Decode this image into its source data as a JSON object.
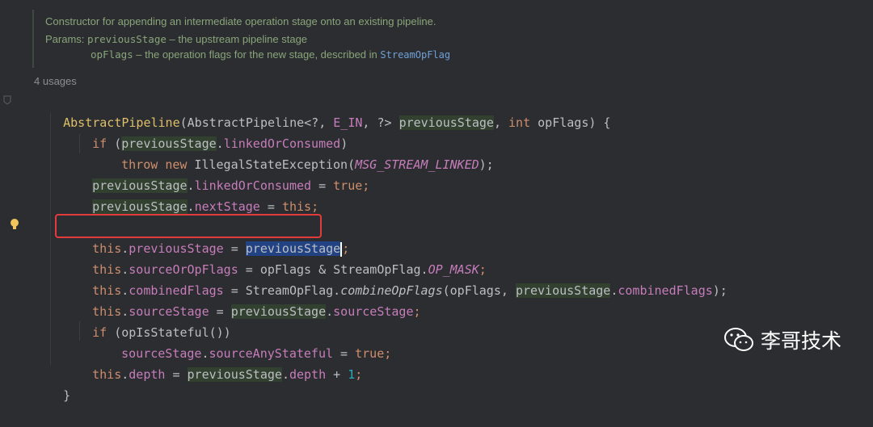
{
  "doc": {
    "description": "Constructor for appending an intermediate operation stage onto an existing pipeline.",
    "params_key": "Params:",
    "param1_name": "previousStage",
    "param1_desc": " – the upstream pipeline stage",
    "param2_name": "opFlags",
    "param2_desc": " – the operation flags for the new stage, described in ",
    "param2_link": "StreamOpFlag"
  },
  "usages": "4 usages",
  "code": {
    "l1": {
      "name": "AbstractPipeline",
      "open": "(AbstractPipeline<?, ",
      "ein": "E_IN",
      "mid": ", ?> ",
      "p1": "previousStage",
      "comma": ", ",
      "int": "int",
      "p2": " opFlags) {"
    },
    "l2": {
      "if": "if",
      "open": " (",
      "ps": "previousStage",
      "dot": ".",
      "field": "linkedOrConsumed",
      "close": ")"
    },
    "l3": {
      "throw": "throw",
      "sp": " ",
      "new": "new",
      "cls": " IllegalStateException(",
      "const": "MSG_STREAM_LINKED",
      "end": ");"
    },
    "l4": {
      "ps": "previousStage",
      "dot": ".",
      "field": "linkedOrConsumed",
      "eq": " = ",
      "true": "true",
      "end": ";"
    },
    "l5": {
      "ps": "previousStage",
      "dot": ".",
      "field": "nextStage",
      "eq": " = ",
      "this": "this",
      "end": ";"
    },
    "l6": {
      "this": "this",
      "dot": ".",
      "field": "previousStage",
      "eq": " = ",
      "sel": "previousStage",
      "end": ";"
    },
    "l7": {
      "this": "this",
      "dot": ".",
      "field": "sourceOrOpFlags",
      "eq": " = opFlags & StreamOpFlag.",
      "const": "OP_MASK",
      "end": ";"
    },
    "l8": {
      "this": "this",
      "dot": ".",
      "field": "combinedFlags",
      "eq": " = StreamOpFlag.",
      "method": "combineOpFlags",
      "args": "(opFlags, ",
      "ps": "previousStage",
      "dot2": ".",
      "field2": "combinedFlags",
      "end": ");"
    },
    "l9": {
      "this": "this",
      "dot": ".",
      "field": "sourceStage",
      "eq": " = ",
      "ps": "previousStage",
      "dot2": ".",
      "field2": "sourceStage",
      "end": ";"
    },
    "l10": {
      "if": "if",
      "rest": " (opIsStateful())"
    },
    "l11": {
      "field": "sourceStage",
      "dot": ".",
      "field2": "sourceAnyStateful",
      "eq": " = ",
      "true": "true",
      "end": ";"
    },
    "l12": {
      "this": "this",
      "dot": ".",
      "field": "depth",
      "eq": " = ",
      "ps": "previousStage",
      "dot2": ".",
      "field2": "depth",
      "end": " + ",
      "num": "1",
      "semi": ";"
    },
    "l13": {
      "brace": "}"
    }
  },
  "watermark": {
    "text": "李哥技术"
  },
  "colors": {
    "keyword": "#cf8e6d",
    "field": "#c77dbb",
    "method": "#e0bf6a",
    "highlight_box": "#e33b3b",
    "selection": "#214283"
  }
}
